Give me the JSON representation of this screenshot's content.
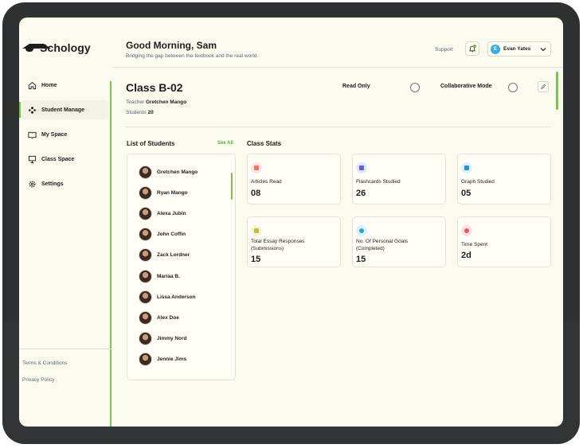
{
  "brand": {
    "name": "Schology"
  },
  "sidebar": {
    "items": [
      {
        "label": "Home",
        "icon": "home-icon"
      },
      {
        "label": "Student Manage",
        "icon": "people-icon"
      },
      {
        "label": "My Space",
        "icon": "book-icon"
      },
      {
        "label": "Class Space",
        "icon": "presentation-icon"
      },
      {
        "label": "Settings",
        "icon": "gear-icon"
      }
    ],
    "links": [
      "Terms & Conditions",
      "Privacy Policy"
    ]
  },
  "header": {
    "greeting": "Good Morning, Sam",
    "subtitle": "Bridging the gap between the textbook and the real world.",
    "support": "Support",
    "user": {
      "initial": "E",
      "name": "Evan Yates"
    }
  },
  "class": {
    "title": "Class B-02",
    "teacher_label": "Teacher",
    "teacher": "Gretchen Mango",
    "students_label": "Students",
    "students": "20",
    "read_only": "Read Only",
    "collab": "Collaborative Mode"
  },
  "students": {
    "title": "List of Students",
    "see_all": "See All",
    "list": [
      "Gretchen Mango",
      "Ryan Mango",
      "Alexa Jubin",
      "John Coffin",
      "Zack Lordner",
      "Mariaa B.",
      "Lissa Anderson",
      "Alex Doe",
      "Jimmy Nord",
      "Jennie Jims"
    ]
  },
  "stats": {
    "title": "Class Stats",
    "cards": [
      {
        "label": "Articles Read",
        "value": "08",
        "color": "#f2736b",
        "bg": "#fde6e2"
      },
      {
        "label": "Flashcards Studied",
        "value": "26",
        "color": "#5b63d6",
        "bg": "#e4e6fb"
      },
      {
        "label": "Graph Studied",
        "value": "05",
        "color": "#2596c8",
        "bg": "#dff2fb"
      },
      {
        "label": "Total Essay Responses (Submissions)",
        "value": "15",
        "color": "#c2c23a",
        "bg": "#f6f6d6"
      },
      {
        "label": "No. Of Personal Goals (Completed)",
        "value": "15",
        "color": "#28a7c9",
        "bg": "#dcf3f8"
      },
      {
        "label": "Time Spent",
        "value": "2d",
        "color": "#e0576a",
        "bg": "#fbe1e4"
      }
    ]
  },
  "colors": {
    "accent": "#7cc24b",
    "background": "#fbfaee"
  }
}
